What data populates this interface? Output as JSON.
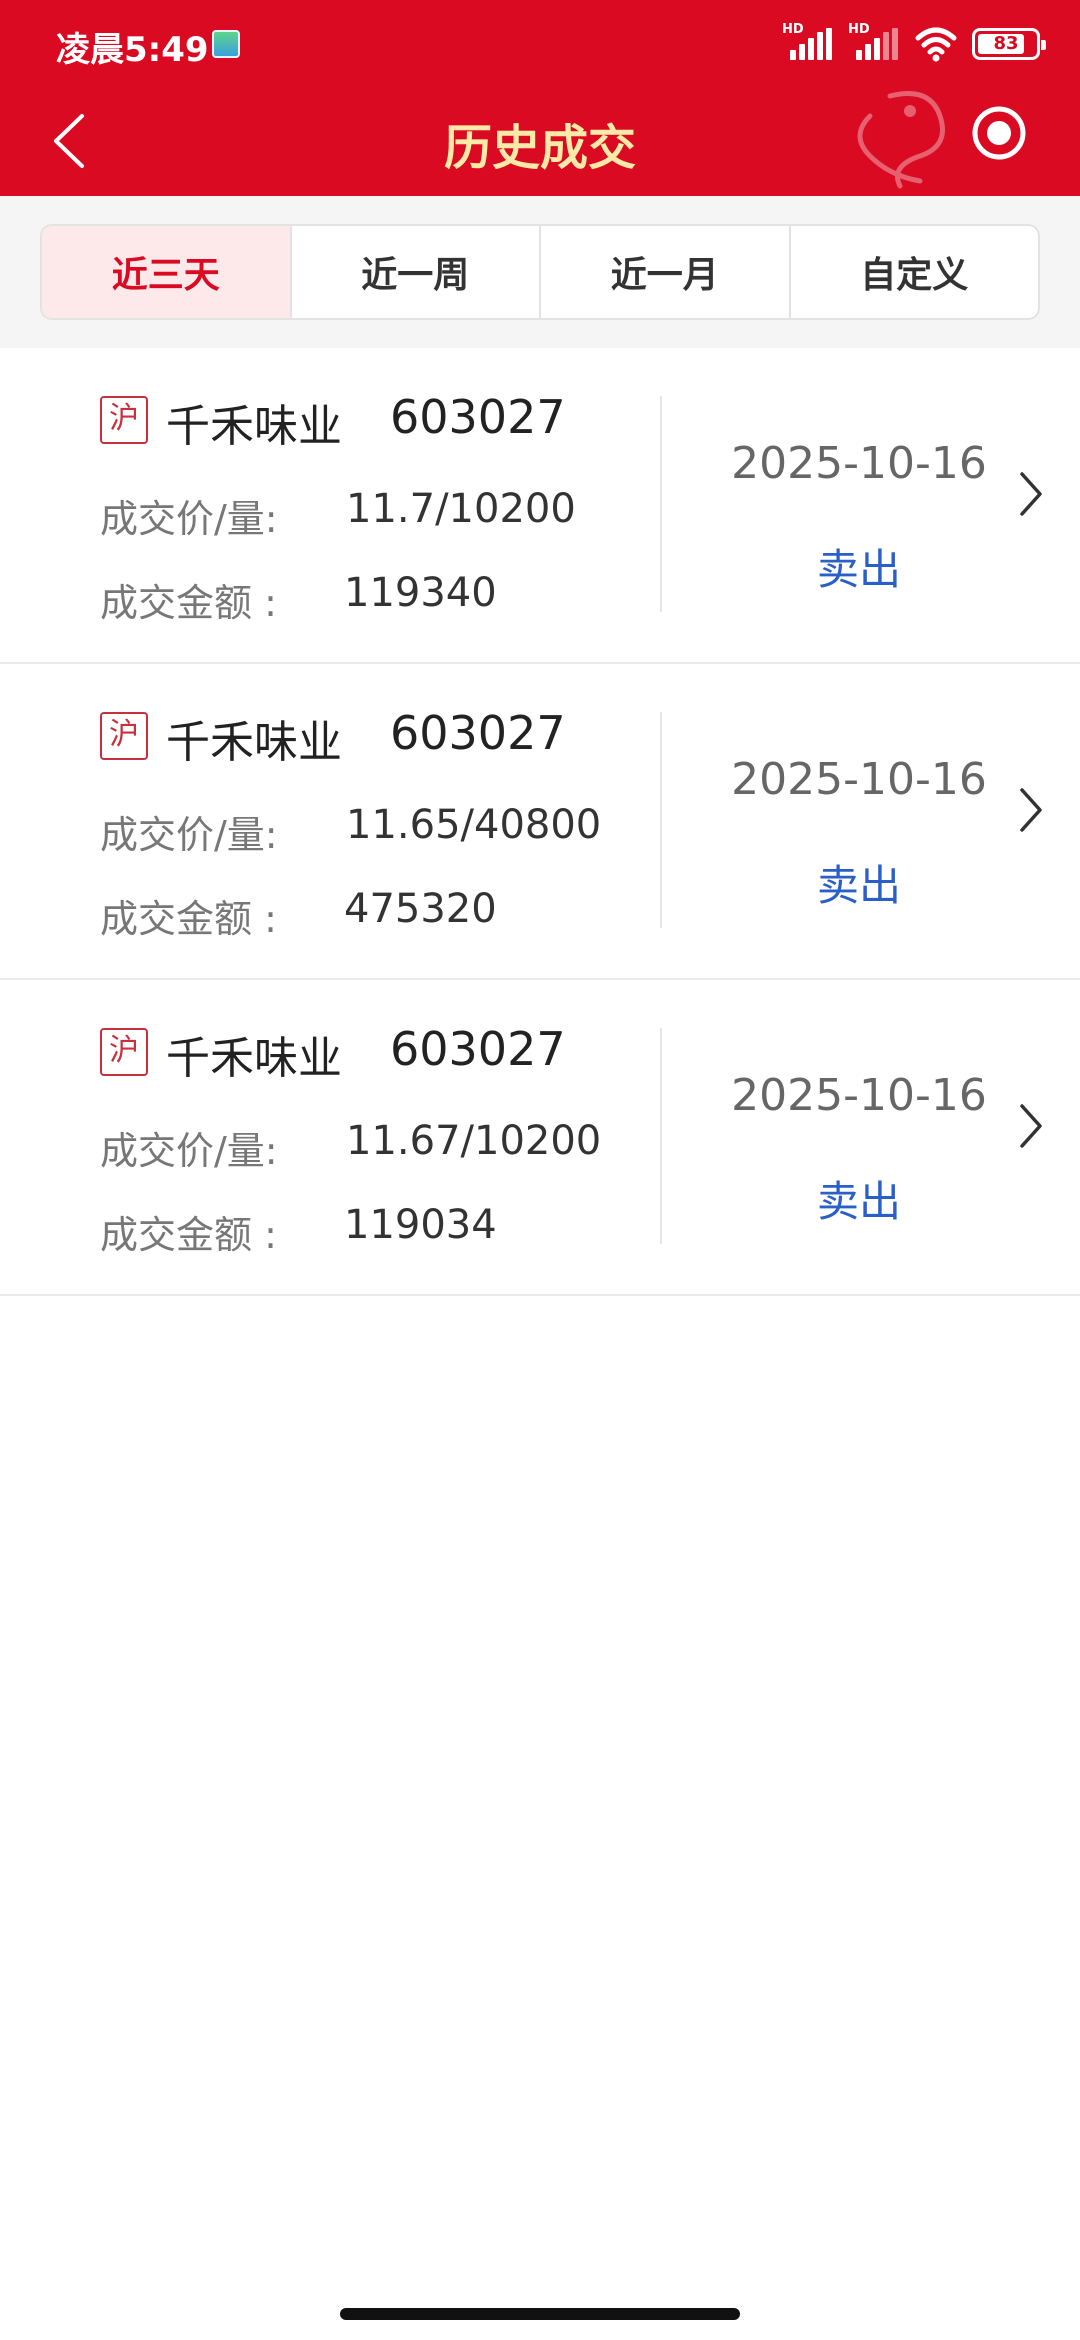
{
  "status_bar": {
    "time": "凌晨5:49",
    "signal_1_label": "HD",
    "signal_2_label": "HD",
    "battery": "83"
  },
  "nav": {
    "title": "历史成交",
    "back_icon": "chevron-left-icon",
    "record_icon": "record-target-icon"
  },
  "tabs": [
    {
      "label": "近三天",
      "active": true
    },
    {
      "label": "近一周",
      "active": false
    },
    {
      "label": "近一月",
      "active": false
    },
    {
      "label": "自定义",
      "active": false
    }
  ],
  "trades": [
    {
      "market": "沪",
      "name": "千禾味业",
      "code": "603027",
      "price_qty_label": "成交价/量:",
      "price_qty": "11.7/10200",
      "amount_label": "成交金额 :",
      "amount": "119340",
      "date": "2025-10-16",
      "direction": "卖出"
    },
    {
      "market": "沪",
      "name": "千禾味业",
      "code": "603027",
      "price_qty_label": "成交价/量:",
      "price_qty": "11.65/40800",
      "amount_label": "成交金额 :",
      "amount": "475320",
      "date": "2025-10-16",
      "direction": "卖出"
    },
    {
      "market": "沪",
      "name": "千禾味业",
      "code": "603027",
      "price_qty_label": "成交价/量:",
      "price_qty": "11.67/10200",
      "amount_label": "成交金额 :",
      "amount": "119034",
      "date": "2025-10-16",
      "direction": "卖出"
    }
  ],
  "colors": {
    "brand_red": "#d90a22",
    "title_gold": "#fbe9a8",
    "sell_blue": "#2a5fc8",
    "active_tab_bg": "#fde8ea"
  }
}
